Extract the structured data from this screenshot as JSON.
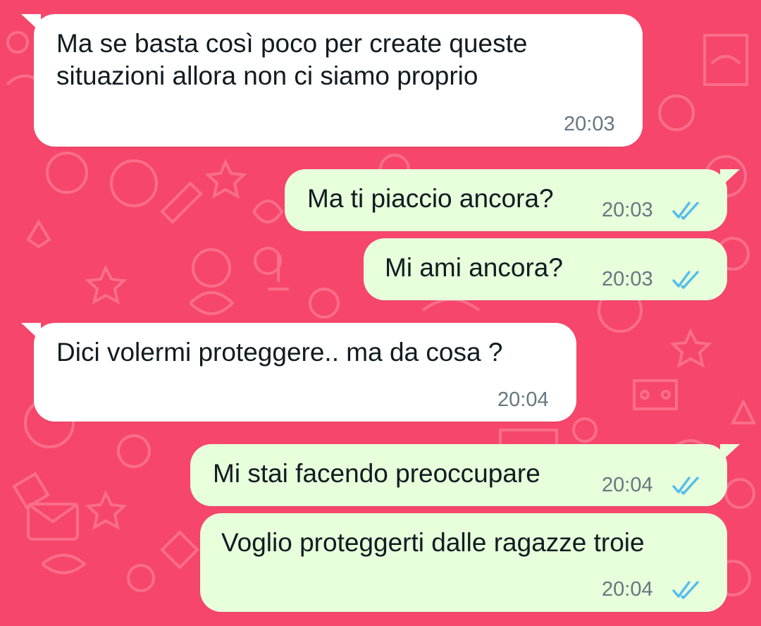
{
  "chat": {
    "accent_colors": {
      "background": "#f7466b",
      "incoming_bubble": "#ffffff",
      "outgoing_bubble": "#e7ffdb",
      "read_ticks": "#53bdeb",
      "timestamp": "#667781"
    },
    "messages": [
      {
        "direction": "incoming",
        "text_line1": "Ma se basta così poco per create queste",
        "text_line2": "situazioni allora non ci siamo proprio",
        "time": "20:03"
      },
      {
        "direction": "outgoing",
        "text": "Ma ti piaccio ancora?",
        "time": "20:03",
        "status_icon": "double-check-read-icon"
      },
      {
        "direction": "outgoing",
        "text": "Mi ami ancora?",
        "time": "20:03",
        "status_icon": "double-check-read-icon"
      },
      {
        "direction": "incoming",
        "text": "Dici volermi proteggere.. ma da cosa ?",
        "time": "20:04"
      },
      {
        "direction": "outgoing",
        "text": "Mi stai facendo preoccupare",
        "time": "20:04",
        "status_icon": "double-check-read-icon"
      },
      {
        "direction": "outgoing",
        "text": "Voglio proteggerti dalle ragazze troie",
        "time": "20:04",
        "status_icon": "double-check-read-icon"
      }
    ]
  }
}
